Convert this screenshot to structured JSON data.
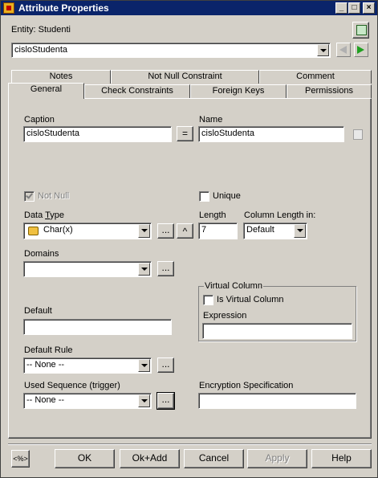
{
  "window": {
    "title": "Attribute Properties",
    "controls": [
      "_",
      "□",
      "×"
    ]
  },
  "entity_label": "Entity: Studenti",
  "attribute_select": {
    "value": "cisloStudenta"
  },
  "tabs_row1": [
    "Notes",
    "Not Null Constraint",
    "Comment"
  ],
  "tabs_row2": [
    "General",
    "Check Constraints",
    "Foreign Keys",
    "Permissions"
  ],
  "general": {
    "caption_label": "Caption",
    "caption_value": "cisloStudenta",
    "equals_label": "=",
    "name_label": "Name",
    "name_value": "cisloStudenta",
    "not_null_label": "Not Null",
    "unique_label": "Unique",
    "data_type_label": "Data Type",
    "data_type_value": "Char(x)",
    "length_label": "Length",
    "length_value": "7",
    "column_length_label": "Column Length in:",
    "column_length_value": "Default",
    "domains_label": "Domains",
    "domains_value": "",
    "virtual_column_label": "Virtual Column",
    "is_virtual_label": "Is Virtual Column",
    "expression_label": "Expression",
    "expression_value": "",
    "default_label": "Default",
    "default_value": "",
    "default_rule_label": "Default Rule",
    "default_rule_value": "-- None --",
    "used_sequence_label": "Used Sequence (trigger)",
    "used_sequence_value": "-- None --",
    "encryption_label": "Encryption Specification",
    "encryption_value": "",
    "ellipsis": "...",
    "caret": "^"
  },
  "footer": {
    "percent_label": "<%>",
    "ok": "OK",
    "ok_add": "Ok+Add",
    "cancel": "Cancel",
    "apply": "Apply",
    "help": "Help"
  }
}
